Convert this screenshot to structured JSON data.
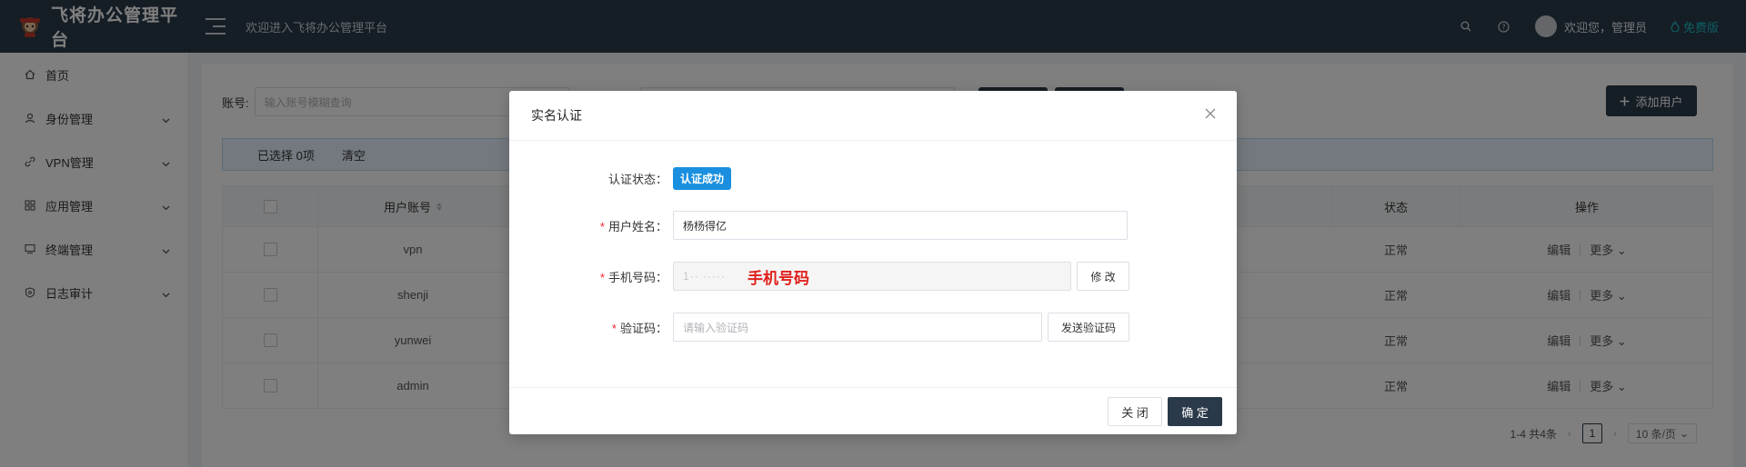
{
  "header": {
    "app_title": "飞将办公管理平台",
    "welcome_text": "欢迎进入飞将办公管理平台",
    "user_greeting": "欢迎您，管理员",
    "edition_label": "免费版"
  },
  "sidebar": {
    "items": [
      {
        "label": "首页",
        "icon": "home-icon"
      },
      {
        "label": "身份管理",
        "icon": "user-icon"
      },
      {
        "label": "VPN管理",
        "icon": "link-icon"
      },
      {
        "label": "应用管理",
        "icon": "grid-icon"
      },
      {
        "label": "终端管理",
        "icon": "monitor-icon"
      },
      {
        "label": "日志审计",
        "icon": "shield-icon"
      }
    ]
  },
  "main": {
    "filter": {
      "account_label": "账号:",
      "account_placeholder": "输入账号模糊查询"
    },
    "add_user_label": "添加用户",
    "selection": {
      "selected_text": "已选择 0项",
      "clear_label": "清空"
    },
    "table": {
      "columns": [
        "用户账号",
        "状态",
        "操作"
      ],
      "rows": [
        {
          "account": "vpn",
          "status": "正常"
        },
        {
          "account": "shenji",
          "status": "正常"
        },
        {
          "account": "yunwei",
          "status": "正常"
        },
        {
          "account": "admin",
          "status": "正常"
        }
      ],
      "edit_label": "编辑",
      "more_label": "更多"
    },
    "pagination": {
      "summary": "1-4 共4条",
      "current_page": "1",
      "page_size": "10 条/页"
    }
  },
  "modal": {
    "title": "实名认证",
    "status_label": "认证状态：",
    "status_value": "认证成功",
    "name_label": "用户姓名：",
    "name_value": "杨杨得亿",
    "phone_label": "手机号码：",
    "phone_masked": "1·· ·····",
    "phone_annotation": "手机号码",
    "modify_label": "修 改",
    "code_label": "验证码：",
    "code_placeholder": "请输入验证码",
    "send_code_label": "发送验证码",
    "close_label": "关 闭",
    "confirm_label": "确 定"
  },
  "colors": {
    "header_bg": "#2b3a4a",
    "primary": "#2b3a4a",
    "badge": "#1a8fe0",
    "edition": "#1bbfc9",
    "annotation": "#e0201c"
  }
}
